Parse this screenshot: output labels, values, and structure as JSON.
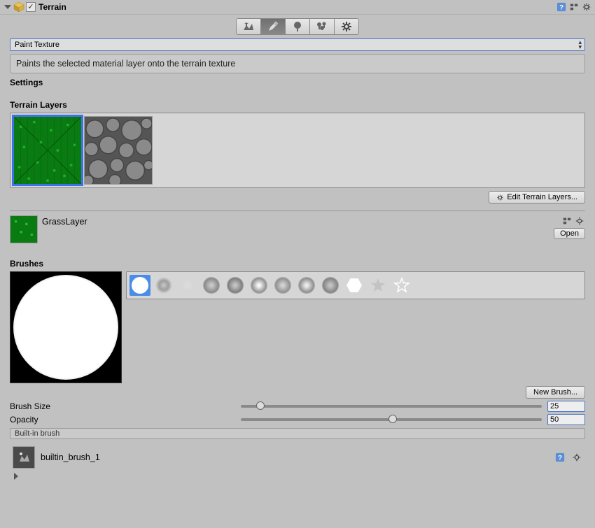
{
  "header": {
    "component_name": "Terrain",
    "enabled": true
  },
  "toolbar": {
    "active_index": 1
  },
  "paint_mode": {
    "selected": "Paint Texture",
    "description": "Paints the selected material layer onto the terrain texture"
  },
  "settings_heading": "Settings",
  "terrain_layers": {
    "heading": "Terrain Layers",
    "edit_button": "Edit Terrain Layers...",
    "selected_index": 0,
    "selected_layer_name": "GrassLayer",
    "open_button": "Open"
  },
  "brushes": {
    "heading": "Brushes",
    "new_button": "New Brush...",
    "selected_index": 0,
    "props": {
      "brush_size_label": "Brush Size",
      "brush_size_value": "25",
      "opacity_label": "Opacity",
      "opacity_value": "50"
    },
    "builtin_bar": "Built-in brush",
    "asset_name": "builtin_brush_1"
  }
}
